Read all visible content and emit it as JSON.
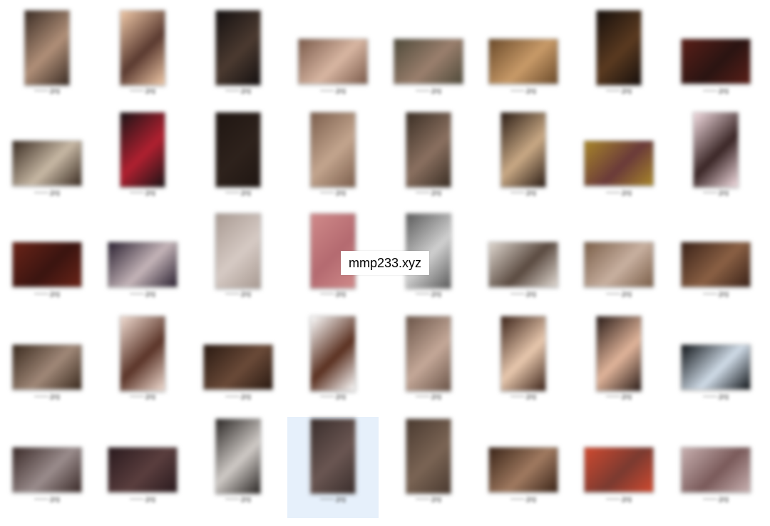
{
  "watermark": "mmp233.xyz",
  "file_label": "——.jpg",
  "selected_index": 35,
  "files": [
    {
      "shape": "portrait",
      "c1": "#3a2c24",
      "c2": "#b08f78"
    },
    {
      "shape": "portrait",
      "c1": "#f0c9a8",
      "c2": "#5a3a30"
    },
    {
      "shape": "portrait",
      "c1": "#141010",
      "c2": "#4b3a30"
    },
    {
      "shape": "landscape",
      "c1": "#7a5a4a",
      "c2": "#d8b6a2"
    },
    {
      "shape": "landscape",
      "c1": "#4f4a3a",
      "c2": "#9a7f6d"
    },
    {
      "shape": "landscape",
      "c1": "#6a4a2a",
      "c2": "#c89a68"
    },
    {
      "shape": "portrait",
      "c1": "#160f0c",
      "c2": "#5a3a20"
    },
    {
      "shape": "landscape",
      "c1": "#5a1f18",
      "c2": "#2a1412"
    },
    {
      "shape": "landscape",
      "c1": "#3a2c22",
      "c2": "#c7b8a4"
    },
    {
      "shape": "portrait",
      "c1": "#1a1416",
      "c2": "#b02030"
    },
    {
      "shape": "portrait",
      "c1": "#1f1612",
      "c2": "#2e221c"
    },
    {
      "shape": "portrait",
      "c1": "#7b5e4c",
      "c2": "#c3a58e"
    },
    {
      "shape": "portrait",
      "c1": "#3a2e24",
      "c2": "#8a7060"
    },
    {
      "shape": "portrait",
      "c1": "#2a1c14",
      "c2": "#c9a985"
    },
    {
      "shape": "landscape",
      "c1": "#a8862a",
      "c2": "#6a3a3a"
    },
    {
      "shape": "portrait",
      "c1": "#f4dde2",
      "c2": "#3a2626"
    },
    {
      "shape": "landscape",
      "c1": "#6a2418",
      "c2": "#3a1410"
    },
    {
      "shape": "landscape",
      "c1": "#2a2030",
      "c2": "#c4b4b8"
    },
    {
      "shape": "portrait",
      "c1": "#a89a92",
      "c2": "#d6cac4"
    },
    {
      "shape": "portrait",
      "c1": "#d08a8a",
      "c2": "#b46a70"
    },
    {
      "shape": "portrait",
      "c1": "#5a5a5a",
      "c2": "#d0d0d0"
    },
    {
      "shape": "landscape",
      "c1": "#e0d8d0",
      "c2": "#5a4a40"
    },
    {
      "shape": "landscape",
      "c1": "#7a5e48",
      "c2": "#c8b0a0"
    },
    {
      "shape": "landscape",
      "c1": "#3a2218",
      "c2": "#8a6044"
    },
    {
      "shape": "landscape",
      "c1": "#3a2a1e",
      "c2": "#a08878"
    },
    {
      "shape": "portrait",
      "c1": "#f2ddd2",
      "c2": "#5a3428"
    },
    {
      "shape": "landscape",
      "c1": "#2a1a12",
      "c2": "#6a4a38"
    },
    {
      "shape": "portrait",
      "c1": "#ffffff",
      "c2": "#5a3020"
    },
    {
      "shape": "portrait",
      "c1": "#6a5448",
      "c2": "#c4a898"
    },
    {
      "shape": "portrait",
      "c1": "#3a2218",
      "c2": "#e8c8ae"
    },
    {
      "shape": "portrait",
      "c1": "#2a1c18",
      "c2": "#e0b49a"
    },
    {
      "shape": "landscape",
      "c1": "#101418",
      "c2": "#d0dce8"
    },
    {
      "shape": "landscape",
      "c1": "#3a2a28",
      "c2": "#9a8c8c"
    },
    {
      "shape": "landscape",
      "c1": "#2a1a1e",
      "c2": "#5a3e3e"
    },
    {
      "shape": "portrait",
      "c1": "#2a2624",
      "c2": "#cfcac6"
    },
    {
      "shape": "portrait",
      "c1": "#3a2e2c",
      "c2": "#6a5652"
    },
    {
      "shape": "portrait",
      "c1": "#4a3a30",
      "c2": "#7a6454"
    },
    {
      "shape": "landscape",
      "c1": "#3a2418",
      "c2": "#a07a60"
    },
    {
      "shape": "landscape",
      "c1": "#d04a30",
      "c2": "#7a3a30"
    },
    {
      "shape": "landscape",
      "c1": "#c8b0b0",
      "c2": "#7a5a5a"
    }
  ]
}
